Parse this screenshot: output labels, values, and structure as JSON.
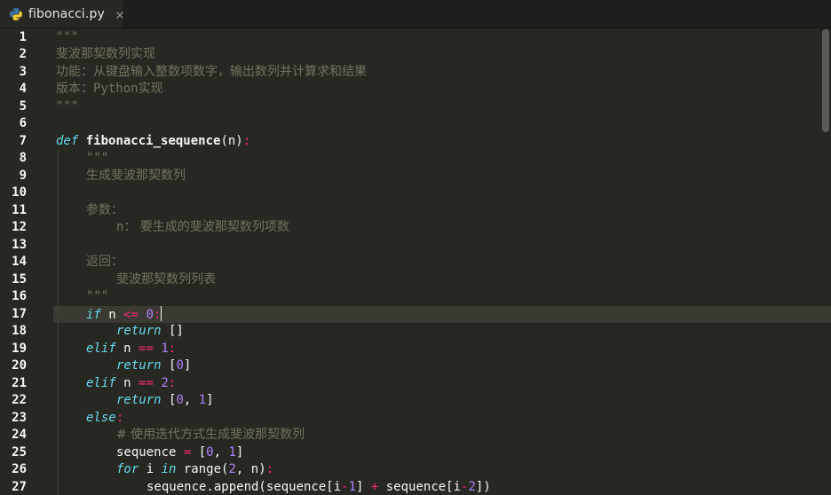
{
  "tab": {
    "filename": "fibonacci.py",
    "icon": "python-icon",
    "close_icon": "close-icon"
  },
  "editor": {
    "active_line": 17,
    "theme": {
      "background": "#272822",
      "keyword": "#66d9ef",
      "operator": "#f92672",
      "number": "#ae81ff",
      "comment": "#75715e",
      "text": "#f8f8f2"
    },
    "line_numbers": [
      "1",
      "2",
      "3",
      "4",
      "5",
      "6",
      "7",
      "8",
      "9",
      "10",
      "11",
      "12",
      "13",
      "14",
      "15",
      "16",
      "17",
      "18",
      "19",
      "20",
      "21",
      "22",
      "23",
      "24",
      "25",
      "26",
      "27"
    ],
    "lines": [
      {
        "indent": 0,
        "tokens": [
          {
            "t": "\"\"\"",
            "c": "c-doc"
          }
        ]
      },
      {
        "indent": 0,
        "tokens": [
          {
            "t": "斐波那契数列实现",
            "c": "c-doc cjk"
          }
        ]
      },
      {
        "indent": 0,
        "tokens": [
          {
            "t": "功能：从键盘输入整数项数字，输出数列并计算求和结果",
            "c": "c-doc cjk"
          }
        ]
      },
      {
        "indent": 0,
        "tokens": [
          {
            "t": "版本：",
            "c": "c-doc cjk"
          },
          {
            "t": "Python",
            "c": "c-doc"
          },
          {
            "t": "实现",
            "c": "c-doc cjk"
          }
        ]
      },
      {
        "indent": 0,
        "tokens": [
          {
            "t": "\"\"\"",
            "c": "c-doc"
          }
        ]
      },
      {
        "indent": 0,
        "tokens": []
      },
      {
        "indent": 0,
        "tokens": [
          {
            "t": "def",
            "c": "c-kw"
          },
          {
            "t": " ",
            "c": "c-txt"
          },
          {
            "t": "fibonacci_sequence",
            "c": "c-fn"
          },
          {
            "t": "(n)",
            "c": "c-txt"
          },
          {
            "t": ":",
            "c": "c-op"
          }
        ]
      },
      {
        "indent": 1,
        "tokens": [
          {
            "t": "\"\"\"",
            "c": "c-doc"
          }
        ]
      },
      {
        "indent": 1,
        "tokens": [
          {
            "t": "生成斐波那契数列",
            "c": "c-doc cjk"
          }
        ]
      },
      {
        "indent": 0,
        "tokens": []
      },
      {
        "indent": 1,
        "tokens": [
          {
            "t": "参数：",
            "c": "c-doc cjk"
          }
        ]
      },
      {
        "indent": 2,
        "tokens": [
          {
            "t": "n",
            "c": "c-doc"
          },
          {
            "t": "： 要生成的斐波那契数列项数",
            "c": "c-doc cjk"
          }
        ]
      },
      {
        "indent": 0,
        "tokens": []
      },
      {
        "indent": 1,
        "tokens": [
          {
            "t": "返回：",
            "c": "c-doc cjk"
          }
        ]
      },
      {
        "indent": 2,
        "tokens": [
          {
            "t": "斐波那契数列列表",
            "c": "c-doc cjk"
          }
        ]
      },
      {
        "indent": 1,
        "tokens": [
          {
            "t": "\"\"\"",
            "c": "c-doc"
          }
        ]
      },
      {
        "indent": 1,
        "tokens": [
          {
            "t": "if",
            "c": "c-kw"
          },
          {
            "t": " n ",
            "c": "c-txt"
          },
          {
            "t": "<=",
            "c": "c-op"
          },
          {
            "t": " ",
            "c": "c-txt"
          },
          {
            "t": "0",
            "c": "c-num"
          },
          {
            "t": ":",
            "c": "c-op"
          }
        ],
        "cursor": true
      },
      {
        "indent": 2,
        "tokens": [
          {
            "t": "return",
            "c": "c-kw"
          },
          {
            "t": " []",
            "c": "c-txt"
          }
        ]
      },
      {
        "indent": 1,
        "tokens": [
          {
            "t": "elif",
            "c": "c-kw"
          },
          {
            "t": " n ",
            "c": "c-txt"
          },
          {
            "t": "==",
            "c": "c-op"
          },
          {
            "t": " ",
            "c": "c-txt"
          },
          {
            "t": "1",
            "c": "c-num"
          },
          {
            "t": ":",
            "c": "c-op"
          }
        ]
      },
      {
        "indent": 2,
        "tokens": [
          {
            "t": "return",
            "c": "c-kw"
          },
          {
            "t": " [",
            "c": "c-txt"
          },
          {
            "t": "0",
            "c": "c-num"
          },
          {
            "t": "]",
            "c": "c-txt"
          }
        ]
      },
      {
        "indent": 1,
        "tokens": [
          {
            "t": "elif",
            "c": "c-kw"
          },
          {
            "t": " n ",
            "c": "c-txt"
          },
          {
            "t": "==",
            "c": "c-op"
          },
          {
            "t": " ",
            "c": "c-txt"
          },
          {
            "t": "2",
            "c": "c-num"
          },
          {
            "t": ":",
            "c": "c-op"
          }
        ]
      },
      {
        "indent": 2,
        "tokens": [
          {
            "t": "return",
            "c": "c-kw"
          },
          {
            "t": " [",
            "c": "c-txt"
          },
          {
            "t": "0",
            "c": "c-num"
          },
          {
            "t": ", ",
            "c": "c-txt"
          },
          {
            "t": "1",
            "c": "c-num"
          },
          {
            "t": "]",
            "c": "c-txt"
          }
        ]
      },
      {
        "indent": 1,
        "tokens": [
          {
            "t": "else",
            "c": "c-kw"
          },
          {
            "t": ":",
            "c": "c-op"
          }
        ]
      },
      {
        "indent": 2,
        "tokens": [
          {
            "t": "# 使用迭代方式生成斐波那契数列",
            "c": "c-cm cjk"
          }
        ]
      },
      {
        "indent": 2,
        "tokens": [
          {
            "t": "sequence ",
            "c": "c-txt"
          },
          {
            "t": "=",
            "c": "c-op"
          },
          {
            "t": " [",
            "c": "c-txt"
          },
          {
            "t": "0",
            "c": "c-num"
          },
          {
            "t": ", ",
            "c": "c-txt"
          },
          {
            "t": "1",
            "c": "c-num"
          },
          {
            "t": "]",
            "c": "c-txt"
          }
        ]
      },
      {
        "indent": 2,
        "tokens": [
          {
            "t": "for",
            "c": "c-kw"
          },
          {
            "t": " i ",
            "c": "c-txt"
          },
          {
            "t": "in",
            "c": "c-kw"
          },
          {
            "t": " range(",
            "c": "c-txt"
          },
          {
            "t": "2",
            "c": "c-num"
          },
          {
            "t": ", n)",
            "c": "c-txt"
          },
          {
            "t": ":",
            "c": "c-op"
          }
        ]
      },
      {
        "indent": 3,
        "tokens": [
          {
            "t": "sequence.append(sequence[i",
            "c": "c-txt"
          },
          {
            "t": "-",
            "c": "c-op"
          },
          {
            "t": "1",
            "c": "c-num"
          },
          {
            "t": "] ",
            "c": "c-txt"
          },
          {
            "t": "+",
            "c": "c-op"
          },
          {
            "t": " sequence[i",
            "c": "c-txt"
          },
          {
            "t": "-",
            "c": "c-op"
          },
          {
            "t": "2",
            "c": "c-num"
          },
          {
            "t": "])",
            "c": "c-txt"
          }
        ]
      }
    ]
  }
}
